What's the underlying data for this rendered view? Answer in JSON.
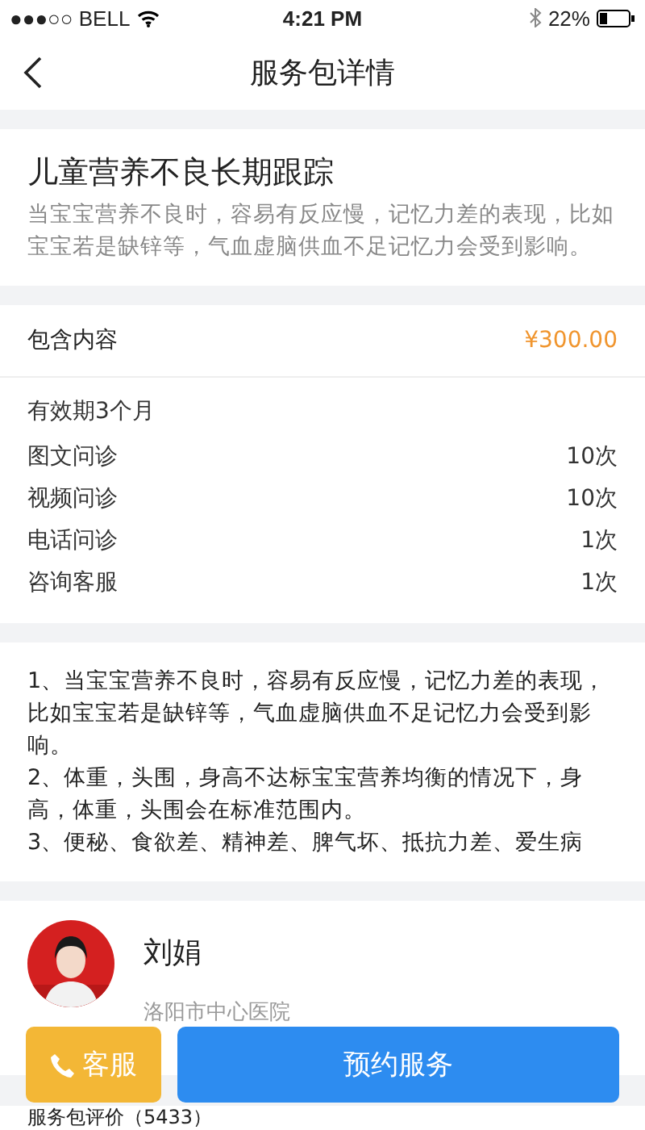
{
  "status_bar": {
    "carrier": "●●●○○ BELL",
    "time": "4:21 PM",
    "battery": "22%"
  },
  "nav": {
    "title": "服务包详情"
  },
  "package": {
    "title": "儿童营养不良长期跟踪",
    "description": "当宝宝营养不良时，容易有反应慢，记忆力差的表现，比如宝宝若是缺锌等，气血虚脑供血不足记忆力会受到影响。"
  },
  "contents": {
    "label": "包含内容",
    "price": "¥300.00",
    "validity": "有效期3个月",
    "items": [
      {
        "name": "图文问诊",
        "count": "10次"
      },
      {
        "name": "视频问诊",
        "count": "10次"
      },
      {
        "name": "电话问诊",
        "count": "1次"
      },
      {
        "name": "咨询客服",
        "count": "1次"
      }
    ]
  },
  "details": [
    "1、当宝宝营养不良时，容易有反应慢，记忆力差的表现，比如宝宝若是缺锌等，气血虚脑供血不足记忆力会受到影响。",
    "2、体重，头围，身高不达标宝宝营养均衡的情况下，身高，体重，头围会在标准范围内。",
    "3、便秘、食欲差、精神差、脾气坏、抵抗力差、爱生病"
  ],
  "doctor": {
    "name": "刘娟",
    "hospital": "洛阳市中心医院"
  },
  "reviews": {
    "label": "服务包评价（5433）"
  },
  "buttons": {
    "service": "客服",
    "book": "预约服务"
  }
}
